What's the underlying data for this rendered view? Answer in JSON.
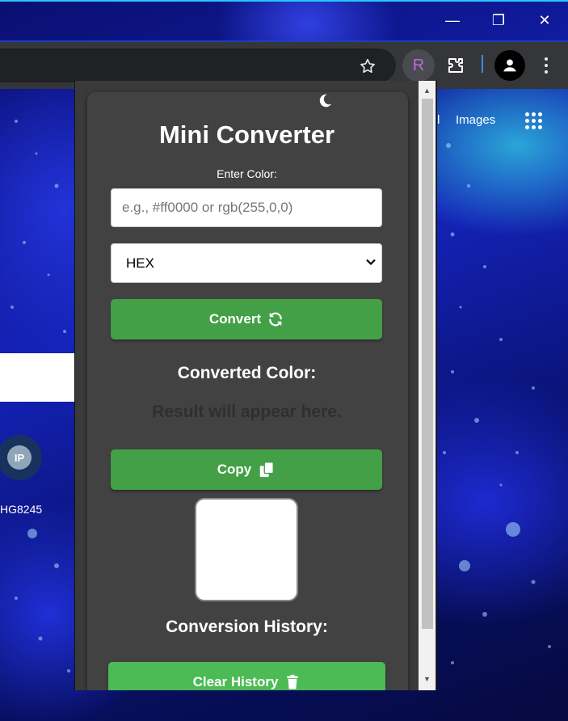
{
  "browser": {
    "window_controls": {
      "minimize": "—",
      "maximize": "❐",
      "close": "✕"
    },
    "extension_avatar_letter": "R",
    "page_links": {
      "partial": "l",
      "images": "Images"
    },
    "ip_badge": "IP",
    "ip_caption": "HG8245"
  },
  "popup": {
    "title": "Mini Converter",
    "input_label": "Enter Color:",
    "input_placeholder": "e.g., #ff0000 or rgb(255,0,0)",
    "input_value": "",
    "format_select": {
      "selected": "HEX"
    },
    "convert_button": "Convert",
    "converted_heading": "Converted Color:",
    "result_text": "Result will appear here.",
    "copy_button": "Copy",
    "swatch_color": "#ffffff",
    "history_heading": "Conversion History:",
    "clear_history_button": "Clear History"
  },
  "colors": {
    "accent_green": "#43a047",
    "card_bg": "#424242",
    "popup_bg": "#3a3a3a",
    "toolbar_bg": "#35363a"
  }
}
